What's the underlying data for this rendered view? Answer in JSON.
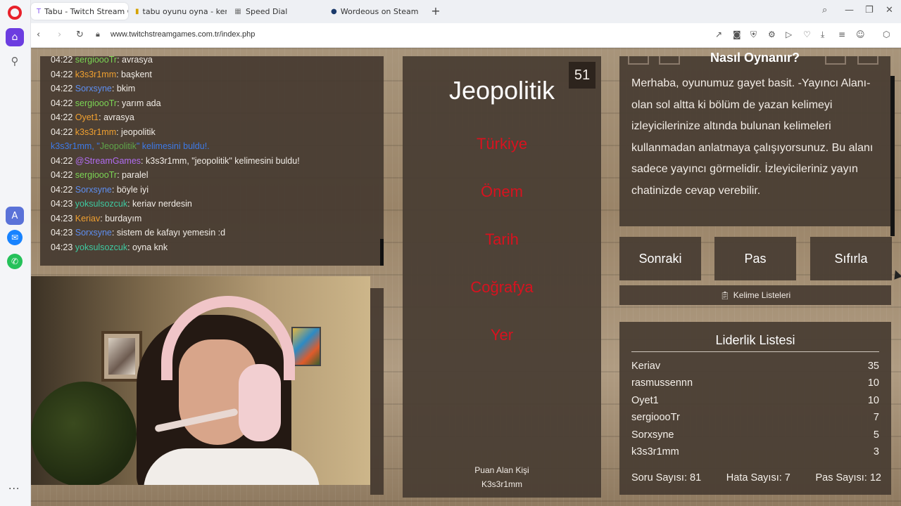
{
  "browser": {
    "tabs": [
      {
        "label": "Tabu - Twitch Stream Gam",
        "favicon": "twitch-icon",
        "active": true
      },
      {
        "label": "tabu oyunu oyna - kendi o",
        "favicon": "yandex-icon",
        "active": false
      },
      {
        "label": "Speed Dial",
        "favicon": "speed-dial-icon",
        "active": false
      },
      {
        "label": "Wordeous on Steam",
        "favicon": "steam-icon",
        "active": false
      }
    ],
    "url": "www.twitchstreamgames.com.tr/index.php"
  },
  "chat": {
    "messages": [
      {
        "time": "04:22",
        "user": "sergioooTr",
        "color": "#7bd454",
        "text": ": avrasya"
      },
      {
        "time": "04:22",
        "user": "k3s3r1mm",
        "color": "#f0a030",
        "text": ": başkent"
      },
      {
        "time": "04:22",
        "user": "Sorxsyne",
        "color": "#5d8ef0",
        "text": ": bkim"
      },
      {
        "time": "04:22",
        "user": "sergioooTr",
        "color": "#7bd454",
        "text": ": yarım ada"
      },
      {
        "time": "04:22",
        "user": "Oyet1",
        "color": "#f0a030",
        "text": ": avrasya"
      },
      {
        "time": "04:22",
        "user": "k3s3r1mm",
        "color": "#f0a030",
        "text": ": jeopolitik"
      },
      {
        "notice": true,
        "pre": "k3s3r1mm, \"",
        "word": "Jeopolitik",
        "post": "\" kelimesini buldu!."
      },
      {
        "time": "04:22",
        "user": "@StreamGames",
        "color": "#b06cf0",
        "text": ": k3s3r1mm, \"jeopolitik\" kelimesini buldu!"
      },
      {
        "time": "04:22",
        "user": "sergioooTr",
        "color": "#7bd454",
        "text": ": paralel"
      },
      {
        "time": "04:22",
        "user": "Sorxsyne",
        "color": "#5d8ef0",
        "text": ": böyle iyi"
      },
      {
        "time": "04:23",
        "user": "yoksulsozcuk",
        "color": "#3ec9a0",
        "text": ": keriav nerdesin"
      },
      {
        "time": "04:23",
        "user": "Keriav",
        "color": "#f0a030",
        "text": ": burdayım"
      },
      {
        "time": "04:23",
        "user": "Sorxsyne",
        "color": "#5d8ef0",
        "text": ": sistem de kafayı yemesin :d"
      },
      {
        "time": "04:23",
        "user": "yoksulsozcuk",
        "color": "#3ec9a0",
        "text": ": oyna knk"
      }
    ]
  },
  "card": {
    "timer": "51",
    "word": "Jeopolitik",
    "taboo": [
      "Türkiye",
      "Önem",
      "Tarih",
      "Coğrafya",
      "Yer"
    ],
    "scorer_label": "Puan Alan Kişi",
    "scorer_name": "K3s3r1mm"
  },
  "howto": {
    "title": "Nasıl Oynanır?",
    "text": "Merhaba, oyunumuz gayet basit. -Yayıncı Alanı- olan sol altta ki bölüm de yazan kelimeyi izleyicilerinize altında bulunan kelimeleri kullanmadan anlatmaya çalışıyorsunuz. Bu alanı sadece yayıncı görmelidir. İzleyicileriniz yayın chatinizde cevap verebilir."
  },
  "buttons": {
    "next": "Sonraki",
    "pass": "Pas",
    "reset": "Sıfırla",
    "word_lists": "Kelime Listeleri"
  },
  "leaderboard": {
    "title": "Liderlik Listesi",
    "rows": [
      {
        "name": "Keriav",
        "score": "35"
      },
      {
        "name": "rasmussennn",
        "score": "10"
      },
      {
        "name": "Oyet1",
        "score": "10"
      },
      {
        "name": "sergioooTr",
        "score": "7"
      },
      {
        "name": "Sorxsyne",
        "score": "5"
      },
      {
        "name": "k3s3r1mm",
        "score": "3"
      }
    ],
    "stats": {
      "questions": "Soru Sayısı: 81",
      "errors": "Hata Sayısı: 7",
      "passes": "Pas Sayısı: 12"
    }
  }
}
